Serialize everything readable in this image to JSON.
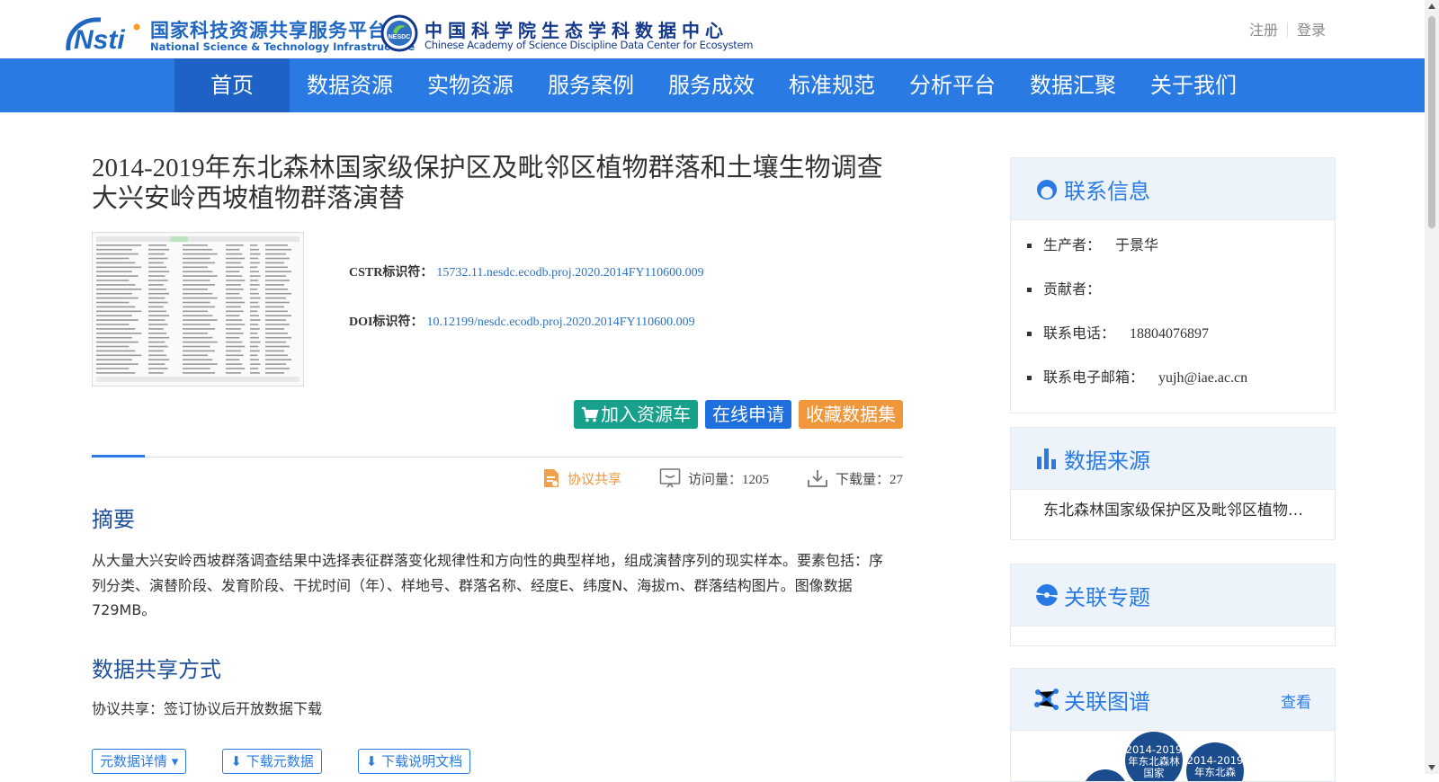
{
  "header": {
    "logo1": {
      "zh": "国家科技资源共享服务平台",
      "en": "National Science & Technology Infrastructure"
    },
    "logo2": {
      "zh": "中国科学院生态学科数据中心",
      "en": "Chinese Academy of Science Discipline Data Center for Ecosystem",
      "badge": "NESDC"
    },
    "register": "注册",
    "login": "登录"
  },
  "nav": [
    {
      "label": "首页",
      "active": true
    },
    {
      "label": "数据资源"
    },
    {
      "label": "实物资源"
    },
    {
      "label": "服务案例"
    },
    {
      "label": "服务成效"
    },
    {
      "label": "标准规范"
    },
    {
      "label": "分析平台"
    },
    {
      "label": "数据汇聚"
    },
    {
      "label": "关于我们"
    }
  ],
  "dataset": {
    "title": "2014-2019年东北森林国家级保护区及毗邻区植物群落和土壤生物调查大兴安岭西坡植物群落演替",
    "cstr_label": "CSTR标识符：",
    "cstr": "15732.11.nesdc.ecodb.proj.2020.2014FY110600.009",
    "doi_label": "DOI标识符：",
    "doi": "10.12199/nesdc.ecodb.proj.2020.2014FY110600.009",
    "btn_cart": "加入资源车",
    "btn_apply": "在线申请",
    "btn_fav": "收藏数据集",
    "share_type": "协议共享",
    "visits": "访问量：1205",
    "downloads": "下载量：27"
  },
  "abstract": {
    "heading": "摘要",
    "text": "从大量大兴安岭西坡群落调查结果中选择表征群落变化规律性和方向性的典型样地，组成演替序列的现实样本。要素包括：序列分类、演替阶段、发育阶段、干扰时间（年）、样地号、群落名称、经度E、纬度N、海拔m、群落结构图片。图像数据729MB。"
  },
  "share": {
    "heading": "数据共享方式",
    "text": "协议共享：签订协议后开放数据下载",
    "buttons": [
      "元数据详情",
      "下载元数据",
      "下载说明文档"
    ]
  },
  "sidebar": {
    "contact": {
      "title": "联系信息",
      "items": [
        {
          "label": "生产者：",
          "value": "于景华"
        },
        {
          "label": "贡献者：",
          "value": ""
        },
        {
          "label": "联系电话：",
          "value": "18804076897"
        },
        {
          "label": "联系电子邮箱：",
          "value": "yujh@iae.ac.cn"
        }
      ]
    },
    "source": {
      "title": "数据来源",
      "text": "东北森林国家级保护区及毗邻区植物群落和土壤生物调查"
    },
    "topic": {
      "title": "关联专题"
    },
    "graph": {
      "title": "关联图谱",
      "more": "查看",
      "nodes": [
        "2014-2019年东北森林国家",
        "2014-2019年东北森"
      ]
    }
  },
  "colors": {
    "nav_bg": "#2a7ae4",
    "nav_active": "#1d62c4",
    "heading": "#1d4f9a",
    "link": "#2b73c4",
    "cart": "#17a08b",
    "apply": "#1f6fdc",
    "fav": "#f0963b"
  }
}
